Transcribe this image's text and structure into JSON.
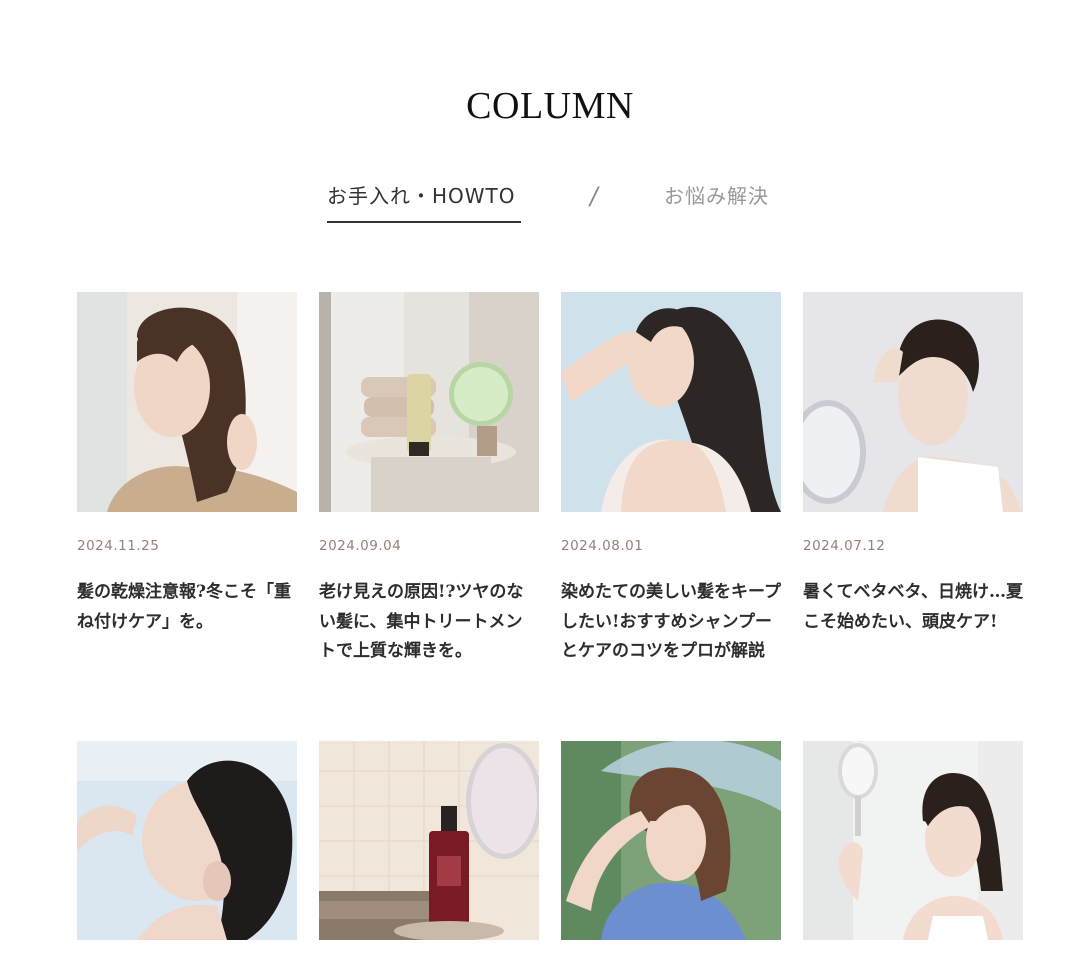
{
  "section": {
    "title": "COLUMN"
  },
  "tabs": [
    {
      "label": "お手入れ・HOWTO",
      "active": true
    },
    {
      "label": "お悩み解決",
      "active": false
    }
  ],
  "tab_separator": "/",
  "articles": [
    {
      "date": "2024.11.25",
      "title": "髪の乾燥注意報?冬こそ「重ね付けケア」を。"
    },
    {
      "date": "2024.09.04",
      "title": "老け見えの原因!?ツヤのない髪に、集中トリートメントで上質な輝きを。"
    },
    {
      "date": "2024.08.01",
      "title": "染めたての美しい髪をキープしたい!おすすめシャンプーとケアのコツをプロが解説"
    },
    {
      "date": "2024.07.12",
      "title": "暑くてベタベタ、日焼け…夏こそ始めたい、頭皮ケア!"
    },
    {
      "date": "",
      "title": ""
    },
    {
      "date": "",
      "title": ""
    },
    {
      "date": "",
      "title": ""
    },
    {
      "date": "",
      "title": ""
    }
  ]
}
